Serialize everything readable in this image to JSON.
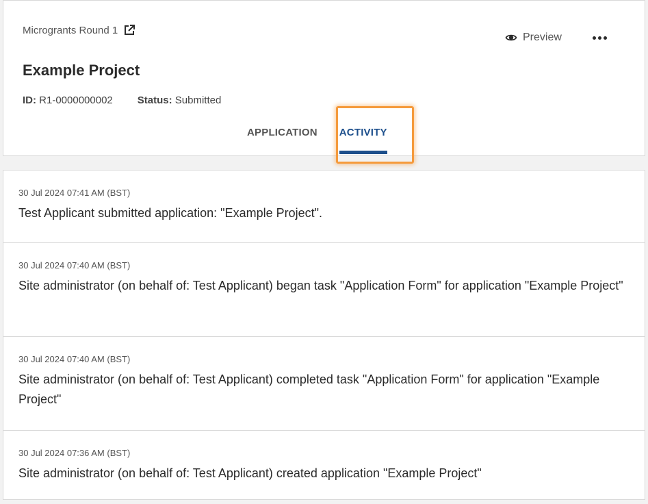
{
  "header": {
    "round_label": "Microgrants Round 1",
    "project_title": "Example Project",
    "id_label": "ID:",
    "id_value": "R1-0000000002",
    "status_label": "Status:",
    "status_value": "Submitted",
    "preview_label": "Preview",
    "icons": {
      "external_link": "external-link-icon",
      "preview": "eye-icon",
      "more": "more-horizontal-icon"
    }
  },
  "tabs": [
    {
      "label": "APPLICATION",
      "active": false
    },
    {
      "label": "ACTIVITY",
      "active": true
    }
  ],
  "activity": [
    {
      "timestamp": "30 Jul 2024 07:41 AM (BST)",
      "message": "Test Applicant submitted application: \"Example Project\"."
    },
    {
      "timestamp": "30 Jul 2024 07:40 AM (BST)",
      "message": "Site administrator (on behalf of: Test Applicant) began task \"Application Form\" for application \"Example Project\""
    },
    {
      "timestamp": "30 Jul 2024 07:40 AM (BST)",
      "message": "Site administrator (on behalf of: Test Applicant) completed task \"Application Form\" for application \"Example Project\""
    },
    {
      "timestamp": "30 Jul 2024 07:36 AM (BST)",
      "message": "Site administrator (on behalf of: Test Applicant) created application \"Example Project\""
    }
  ],
  "colors": {
    "accent": "#1d4f8c",
    "highlight": "#f59a3c",
    "border": "#d9d9d9"
  }
}
